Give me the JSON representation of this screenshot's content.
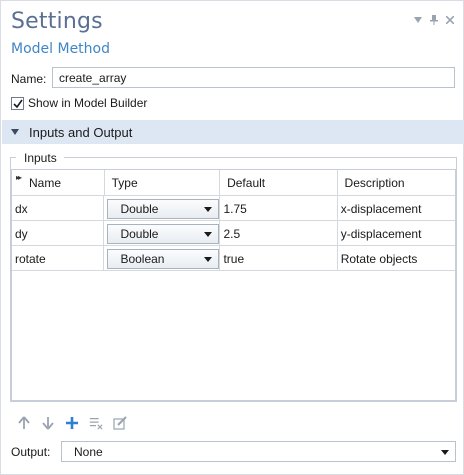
{
  "window": {
    "title": "Settings",
    "subtitle": "Model Method",
    "controls": [
      "chevron-down-icon",
      "pin-icon",
      "close-icon"
    ]
  },
  "form": {
    "name_label": "Name:",
    "name_value": "create_array",
    "show_label": "Show in Model Builder",
    "show_checked": true
  },
  "section": {
    "title": "Inputs and Output",
    "expanded": true
  },
  "inputs": {
    "group_title": "Inputs",
    "columns": [
      "Name",
      "Type",
      "Default",
      "Description"
    ],
    "rows": [
      {
        "name": "dx",
        "type": "Double",
        "default": "1.75",
        "description": "x-displacement"
      },
      {
        "name": "dy",
        "type": "Double",
        "default": "2.5",
        "description": "y-displacement"
      },
      {
        "name": "rotate",
        "type": "Boolean",
        "default": "true",
        "description": "Rotate objects"
      }
    ]
  },
  "toolbar": {
    "icons": [
      "move-up-icon",
      "move-down-icon",
      "add-icon",
      "delete-icon",
      "edit-icon"
    ]
  },
  "output": {
    "label": "Output:",
    "value": "None"
  },
  "colors": {
    "title": "#5a6f93",
    "subtitle": "#3f86c8",
    "section_bg": "#dde7f3",
    "add_icon": "#2f7fd0"
  }
}
